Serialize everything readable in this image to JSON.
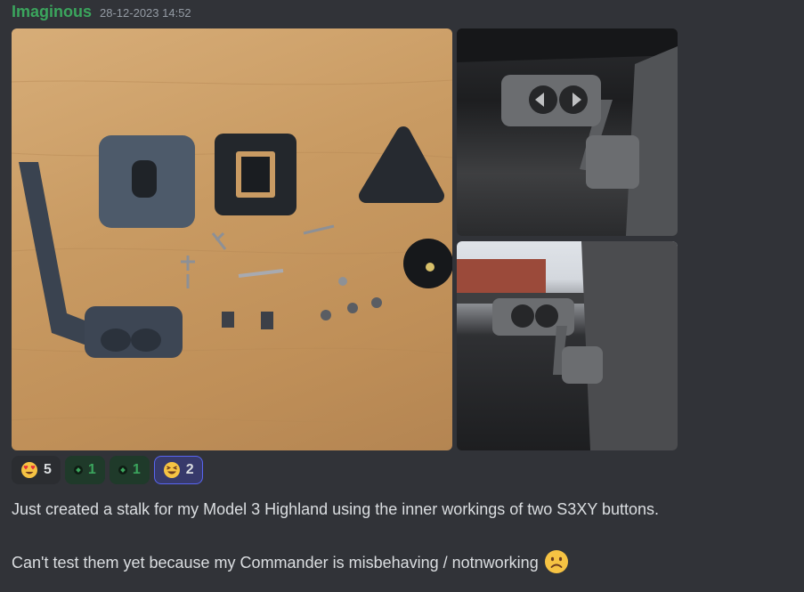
{
  "message": {
    "username": "Imaginous",
    "timestamp": "28-12-2023 14:52",
    "text_line_1": "Just created a stalk for my Model 3 Highland using the inner workings of two S3XY buttons.",
    "text_line_2": "Can't test them yet because my Commander is misbehaving / notnworking",
    "trailing_emoji": "slightly-frowning-face-icon"
  },
  "attachments": [
    {
      "name": "parts-photo",
      "description_icon": "image"
    },
    {
      "name": "stalk-mounted-photo-1",
      "description_icon": "image"
    },
    {
      "name": "stalk-mounted-photo-2",
      "description_icon": "image"
    }
  ],
  "reactions": [
    {
      "emoji": "heart-eyes-icon",
      "count": "5",
      "active": false
    },
    {
      "emoji": "green-gem-icon",
      "count": "1",
      "active": false
    },
    {
      "emoji": "green-gem-icon",
      "count": "1",
      "active": false
    },
    {
      "emoji": "grinning-squint-icon",
      "count": "2",
      "active": true
    }
  ],
  "colors": {
    "background": "#313338",
    "username": "#3ba55d",
    "timestamp": "#949ba4",
    "text": "#dbdee1",
    "active_reaction_border": "#5865f2"
  }
}
